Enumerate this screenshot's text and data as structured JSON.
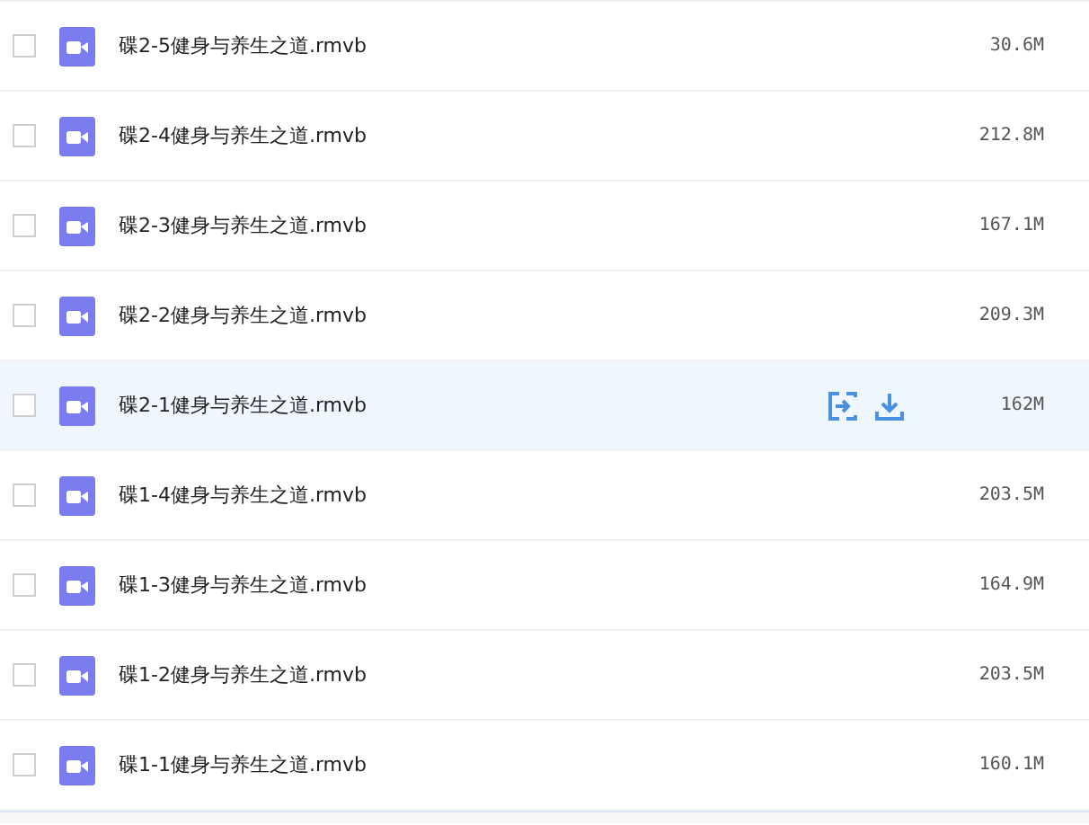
{
  "files": [
    {
      "name": "碟2-5健身与养生之道.rmvb",
      "size": "30.6M",
      "checked": false,
      "hovered": false
    },
    {
      "name": "碟2-4健身与养生之道.rmvb",
      "size": "212.8M",
      "checked": false,
      "hovered": false
    },
    {
      "name": "碟2-3健身与养生之道.rmvb",
      "size": "167.1M",
      "checked": false,
      "hovered": false
    },
    {
      "name": "碟2-2健身与养生之道.rmvb",
      "size": "209.3M",
      "checked": false,
      "hovered": false
    },
    {
      "name": "碟2-1健身与养生之道.rmvb",
      "size": "162M",
      "checked": false,
      "hovered": true
    },
    {
      "name": "碟1-4健身与养生之道.rmvb",
      "size": "203.5M",
      "checked": false,
      "hovered": false
    },
    {
      "name": "碟1-3健身与养生之道.rmvb",
      "size": "164.9M",
      "checked": false,
      "hovered": false
    },
    {
      "name": "碟1-2健身与养生之道.rmvb",
      "size": "203.5M",
      "checked": false,
      "hovered": false
    },
    {
      "name": "碟1-1健身与养生之道.rmvb",
      "size": "160.1M",
      "checked": false,
      "hovered": false
    }
  ]
}
